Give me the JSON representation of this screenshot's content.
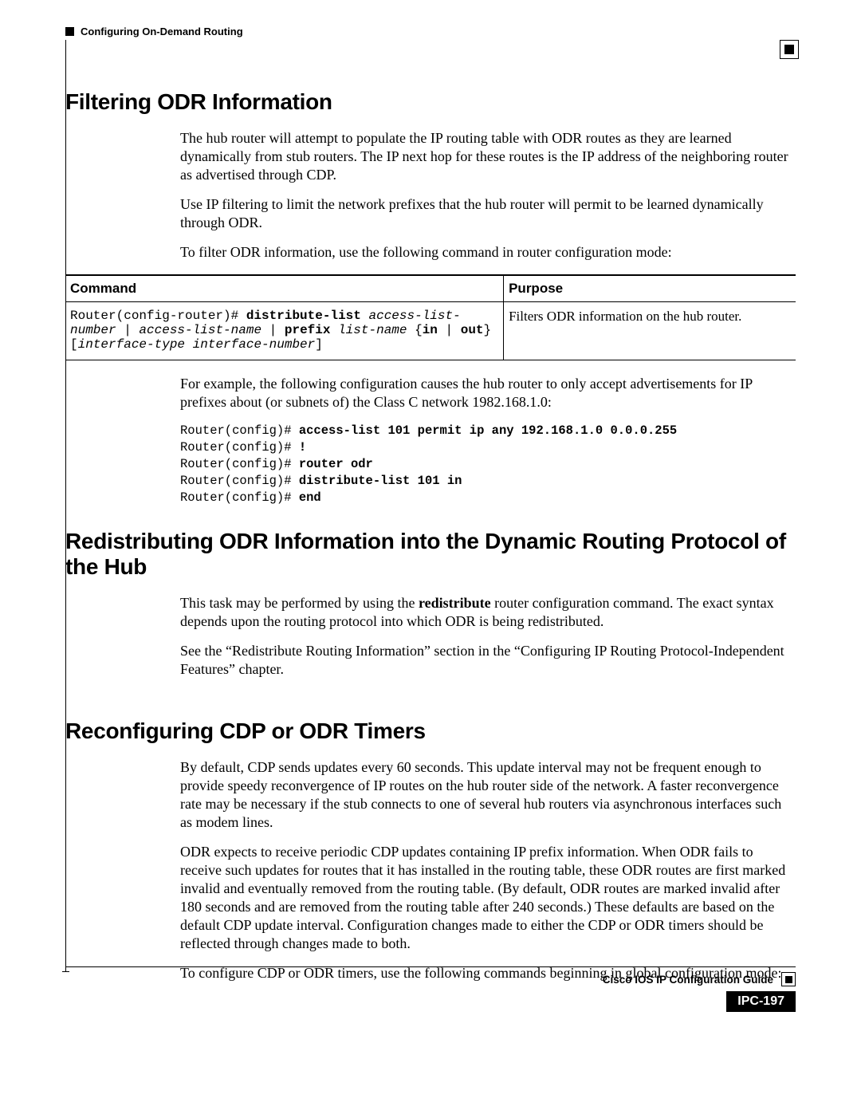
{
  "header": {
    "chapter": "Configuring On-Demand Routing"
  },
  "sections": {
    "filtering": {
      "title": "Filtering ODR Information",
      "p1": "The hub router will attempt to populate the IP routing table with ODR routes as they are learned dynamically from stub routers. The IP next hop for these routes is the IP address of the neighboring router as advertised through CDP.",
      "p2": "Use IP filtering to limit the network prefixes that the hub router will permit to be learned dynamically through ODR.",
      "p3": "To filter ODR information, use the following command in router configuration mode:",
      "table": {
        "h1": "Command",
        "h2": "Purpose",
        "cmd_prompt": "Router(config-router)# ",
        "cmd_b1": "distribute-list",
        "cmd_sp1": " ",
        "cmd_i1": "access-list-number",
        "cmd_sp2": " | ",
        "cmd_i2": "access-list-name",
        "cmd_sp3": " | ",
        "cmd_b2": "prefix",
        "cmd_sp4": " ",
        "cmd_i3": "list-name",
        "cmd_sp5": " {",
        "cmd_b3": "in",
        "cmd_sp6": " | ",
        "cmd_b4": "out",
        "cmd_sp7": "} [",
        "cmd_i4": "interface-type interface-number",
        "cmd_sp8": "]",
        "purpose": "Filters ODR information on the hub router."
      },
      "p4": "For example, the following configuration causes the hub router to only accept advertisements for IP prefixes about (or subnets of) the Class C network 1982.168.1.0:",
      "code": {
        "l1a": "Router(config)# ",
        "l1b": "access-list 101 permit ip any 192.168.1.0 0.0.0.255",
        "l2a": "Router(config)# ",
        "l2b": "!",
        "l3a": "Router(config)# ",
        "l3b": "router odr",
        "l4a": "Router(config)# ",
        "l4b": "distribute-list 101 in",
        "l5a": "Router(config)# ",
        "l5b": "end"
      }
    },
    "redistributing": {
      "title": "Redistributing ODR Information into the Dynamic Routing Protocol of the Hub",
      "p1a": "This task may be performed by using the ",
      "p1b": "redistribute",
      "p1c": " router configuration command. The exact syntax depends upon the routing protocol into which ODR is being redistributed.",
      "p2": "See the “Redistribute Routing Information” section in the “Configuring IP Routing Protocol-Independent Features” chapter."
    },
    "timers": {
      "title": "Reconfiguring CDP or ODR Timers",
      "p1": "By default, CDP sends updates every 60 seconds. This update interval may not be frequent enough to provide speedy reconvergence of IP routes on the hub router side of the network. A faster reconvergence rate may be necessary if the stub connects to one of several hub routers via asynchronous interfaces such as modem lines.",
      "p2": "ODR expects to receive periodic CDP updates containing IP prefix information. When ODR fails to receive such updates for routes that it has installed in the routing table, these ODR routes are first marked invalid and eventually removed from the routing table. (By default, ODR routes are marked invalid after 180 seconds and are removed from the routing table after 240 seconds.) These defaults are based on the default CDP update interval. Configuration changes made to either the CDP or ODR timers should be reflected through changes made to both.",
      "p3": "To configure CDP or ODR timers, use the following commands beginning in global configuration mode:"
    }
  },
  "footer": {
    "guide": "Cisco IOS IP Configuration Guide",
    "page": "IPC-197"
  }
}
